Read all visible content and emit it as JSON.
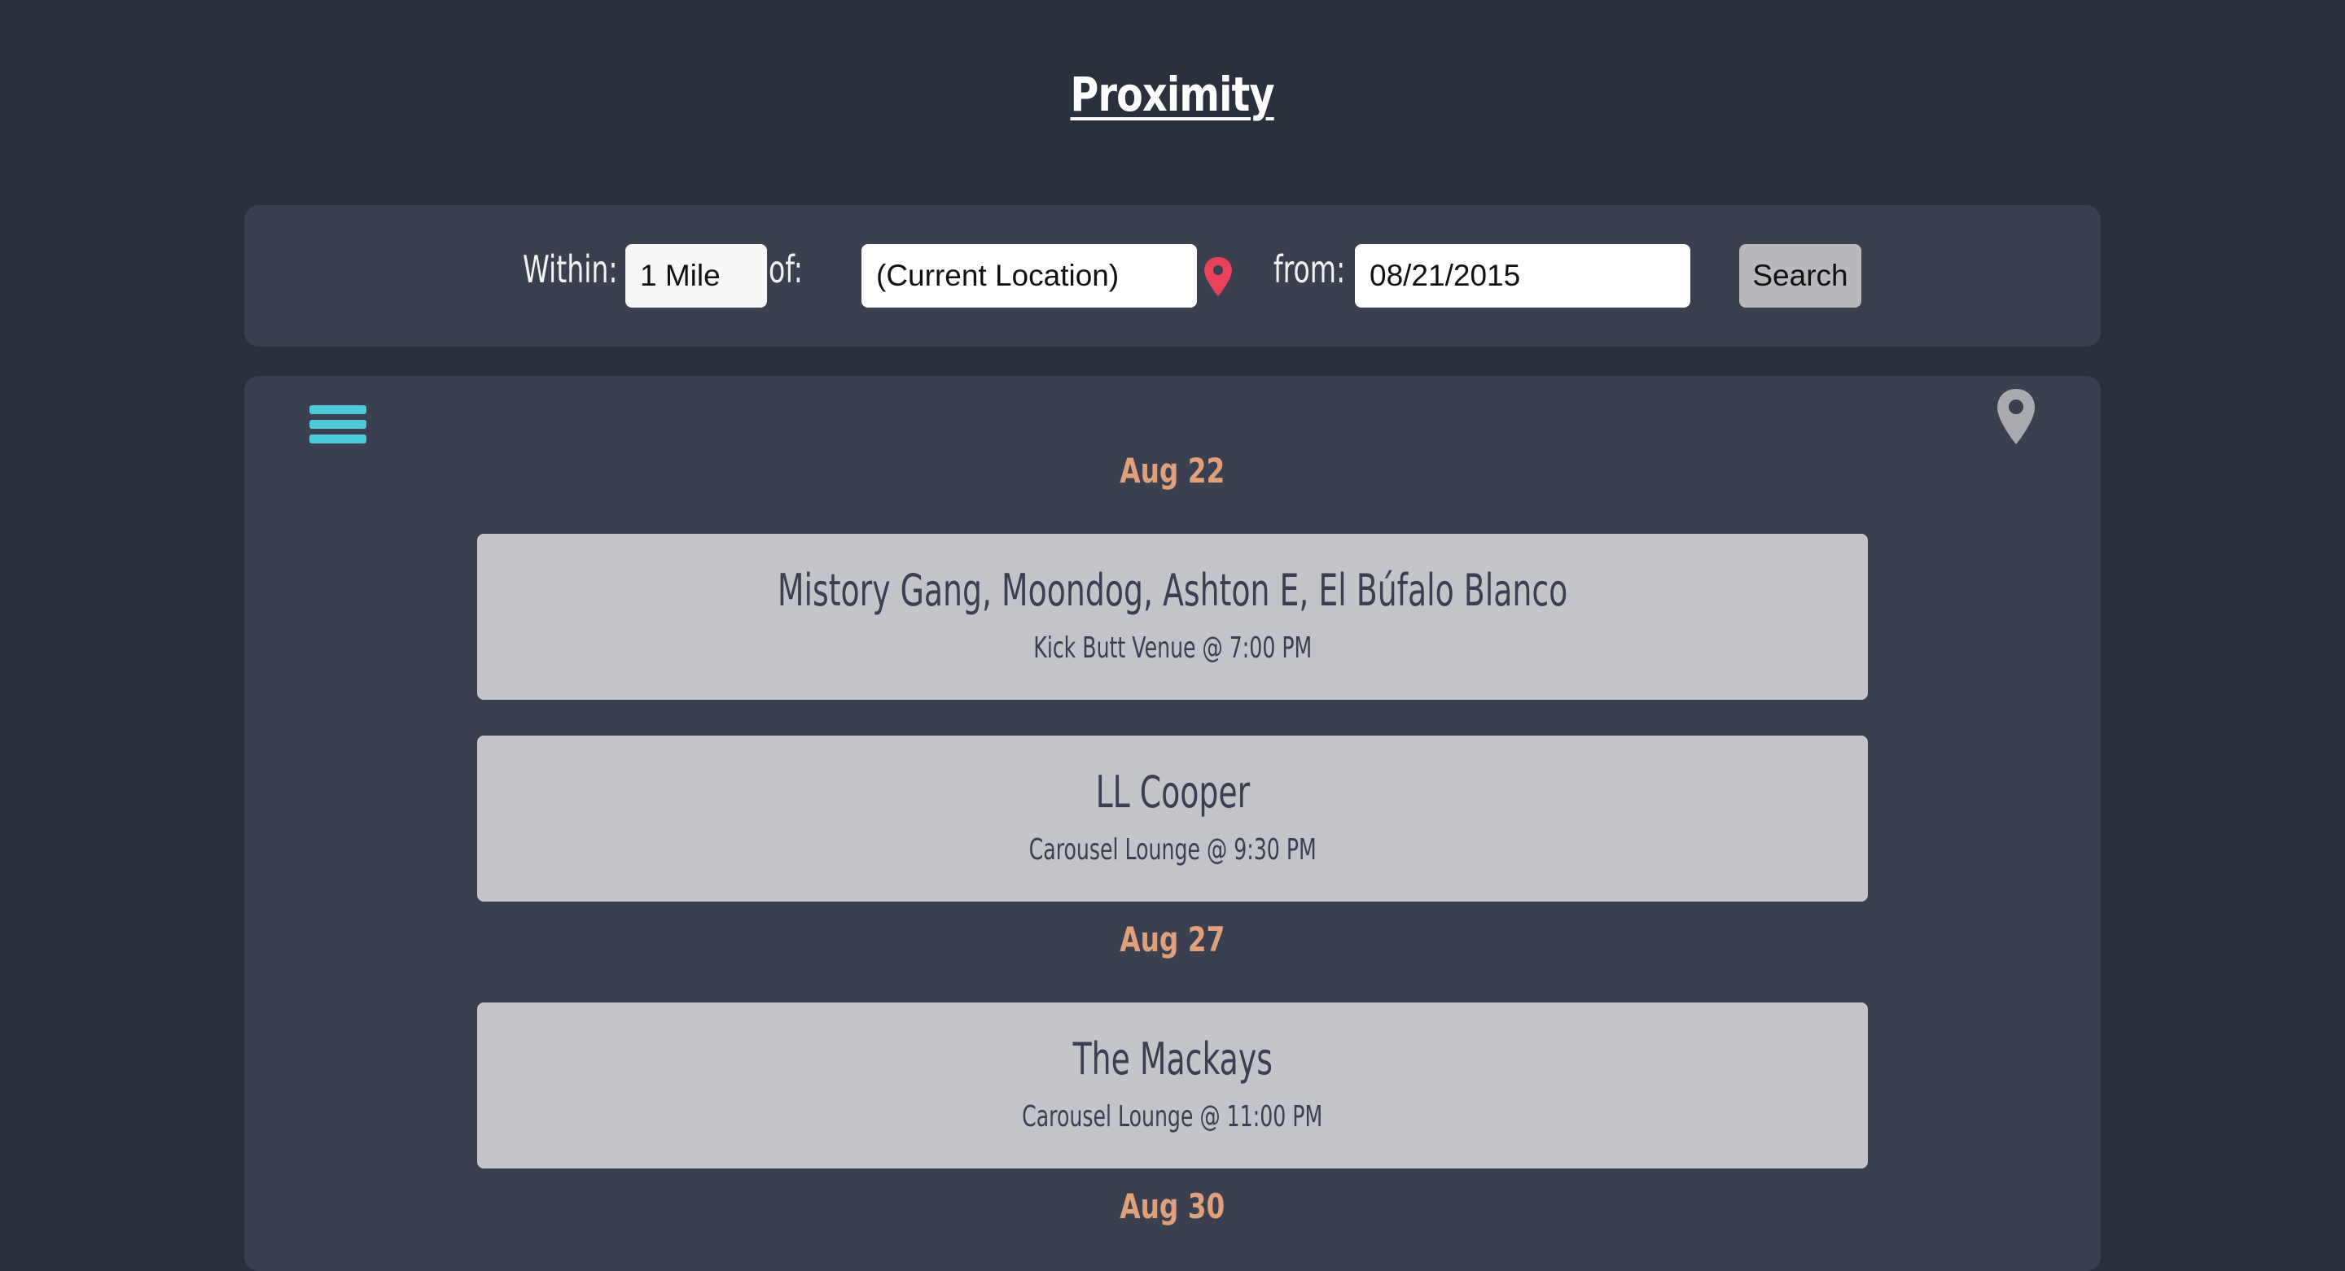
{
  "app": {
    "title": "Proximity"
  },
  "search": {
    "within_label": "Within:",
    "within_value": "1 Mile",
    "of_label": "of:",
    "of_value": "(Current Location)",
    "from_label": "from:",
    "from_value": "08/21/2015",
    "button_label": "Search"
  },
  "icons": {
    "menu": "hamburger-menu-icon",
    "map": "map-pin-icon",
    "location": "location-pin-icon"
  },
  "colors": {
    "background": "#2a303d",
    "panel": "#3a4050",
    "card": "#c3c4c9",
    "date_heading": "#e0a07c",
    "menu_icon": "#4ec9d8",
    "location_pin": "#e8425a",
    "map_pin": "#a9aab0"
  },
  "groups": [
    {
      "date": "Aug 22",
      "events": [
        {
          "title": "Mistory Gang, Moondog, Ashton E, El Búfalo Blanco",
          "details": "Kick Butt Venue @ 7:00 PM"
        },
        {
          "title": "LL Cooper",
          "details": "Carousel Lounge @ 9:30 PM"
        }
      ]
    },
    {
      "date": "Aug 27",
      "events": [
        {
          "title": "The Mackays",
          "details": "Carousel Lounge @ 11:00 PM"
        }
      ]
    },
    {
      "date": "Aug 30",
      "events": []
    }
  ]
}
